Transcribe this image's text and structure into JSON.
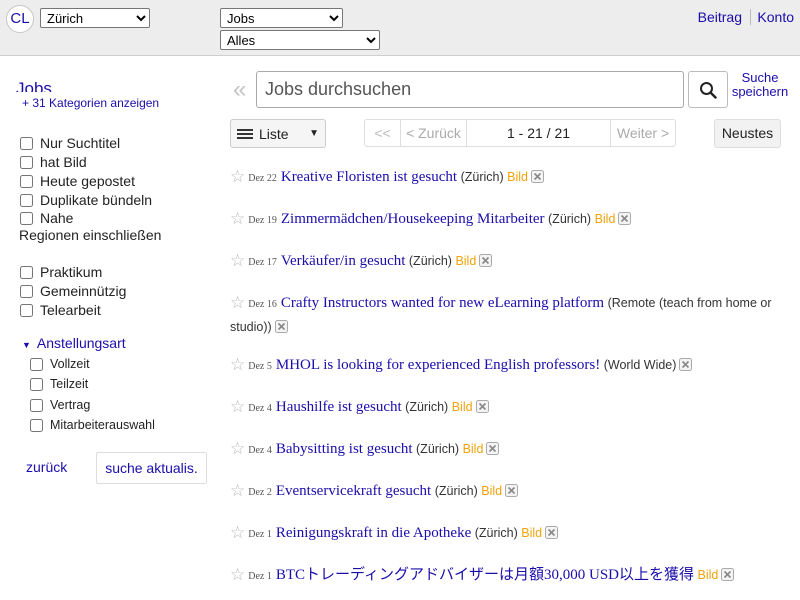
{
  "header": {
    "logo": "CL",
    "city": "Zürich",
    "category": "Jobs",
    "subcategory": "Alles",
    "post_link": "Beitrag",
    "account_link": "Konto"
  },
  "sidebar": {
    "title": "Jobs",
    "categories_link": "+ 31 Kategorien anzeigen",
    "filters": [
      "Nur Suchtitel",
      "hat Bild",
      "Heute gepostet",
      "Duplikate bündeln",
      "Nahe"
    ],
    "regions_text": "Regionen einschließen",
    "filters2": [
      "Praktikum",
      "Gemeinnützig",
      "Telearbeit"
    ],
    "employment_type": "Anstellungsart",
    "employment_options": [
      "Vollzeit",
      "Teilzeit",
      "Vertrag",
      "Mitarbeiterauswahl"
    ],
    "back": "zurück",
    "update": "suche aktualis."
  },
  "search": {
    "placeholder": "Jobs durchsuchen",
    "save_label": "Suche speichern"
  },
  "toolbar": {
    "view": "Liste",
    "first": "<<",
    "prev": "< Zurück",
    "range": "1 - 21 / 21",
    "next": "Weiter >",
    "sort": "Neustes"
  },
  "results": [
    {
      "date": "Dez 22",
      "title": "Kreative Floristen ist gesucht",
      "loc": "(Zürich)",
      "pic": "Bild"
    },
    {
      "date": "Dez 19",
      "title": "Zimmermädchen/Housekeeping Mitarbeiter",
      "loc": "(Zürich)",
      "pic": "Bild"
    },
    {
      "date": "Dez 17",
      "title": "Verkäufer/in gesucht",
      "loc": "(Zürich)",
      "pic": "Bild"
    },
    {
      "date": "Dez 16",
      "title": "Crafty Instructors wanted for new eLearning platform",
      "loc": "(Remote (teach from home or studio))",
      "pic": ""
    },
    {
      "date": "Dez 5",
      "title": "MHOL is looking for experienced English professors!",
      "loc": "(World Wide)",
      "pic": ""
    },
    {
      "date": "Dez 4",
      "title": "Haushilfe ist gesucht",
      "loc": "(Zürich)",
      "pic": "Bild"
    },
    {
      "date": "Dez 4",
      "title": "Babysitting ist gesucht",
      "loc": "(Zürich)",
      "pic": "Bild"
    },
    {
      "date": "Dez 2",
      "title": "Eventservicekraft gesucht",
      "loc": "(Zürich)",
      "pic": "Bild"
    },
    {
      "date": "Dez 1",
      "title": "Reinigungskraft in die Apotheke",
      "loc": "(Zürich)",
      "pic": "Bild"
    },
    {
      "date": "Dez 1",
      "title": "BTCトレーディングアドバイザーは月額30,000 USD以上を獲得",
      "loc": "",
      "pic": "Bild"
    }
  ]
}
